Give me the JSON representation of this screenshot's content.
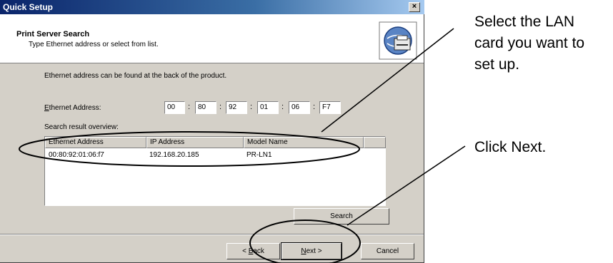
{
  "window": {
    "title": "Quick Setup",
    "close_glyph": "×"
  },
  "header": {
    "title": "Print Server Search",
    "subtitle": "Type Ethernet address or select from list.",
    "icon": "printer-network-icon"
  },
  "form": {
    "info_text": "Ethernet address can be found at the back of the product.",
    "ethernet_label_accel": "E",
    "ethernet_label_rest": "thernet Address:",
    "mac_octets": [
      "00",
      "80",
      "92",
      "01",
      "06",
      "F7"
    ],
    "search_result_label": "Search result overview:"
  },
  "results": {
    "columns": [
      "Ethernet Address",
      "IP Address",
      "Model Name",
      ""
    ],
    "rows": [
      {
        "ethernet": "00:80:92:01:06:f7",
        "ip": "192.168.20.185",
        "model": "PR-LN1"
      }
    ]
  },
  "buttons": {
    "search": "Search",
    "back_prefix": "< ",
    "back_accel": "B",
    "back_rest": "ack",
    "next_accel": "N",
    "next_rest": "ext >",
    "cancel": "Cancel"
  },
  "callouts": {
    "select_line1": "Select the LAN",
    "select_line2": "card you want to",
    "select_line3": "set up.",
    "click_next": "Click Next."
  }
}
